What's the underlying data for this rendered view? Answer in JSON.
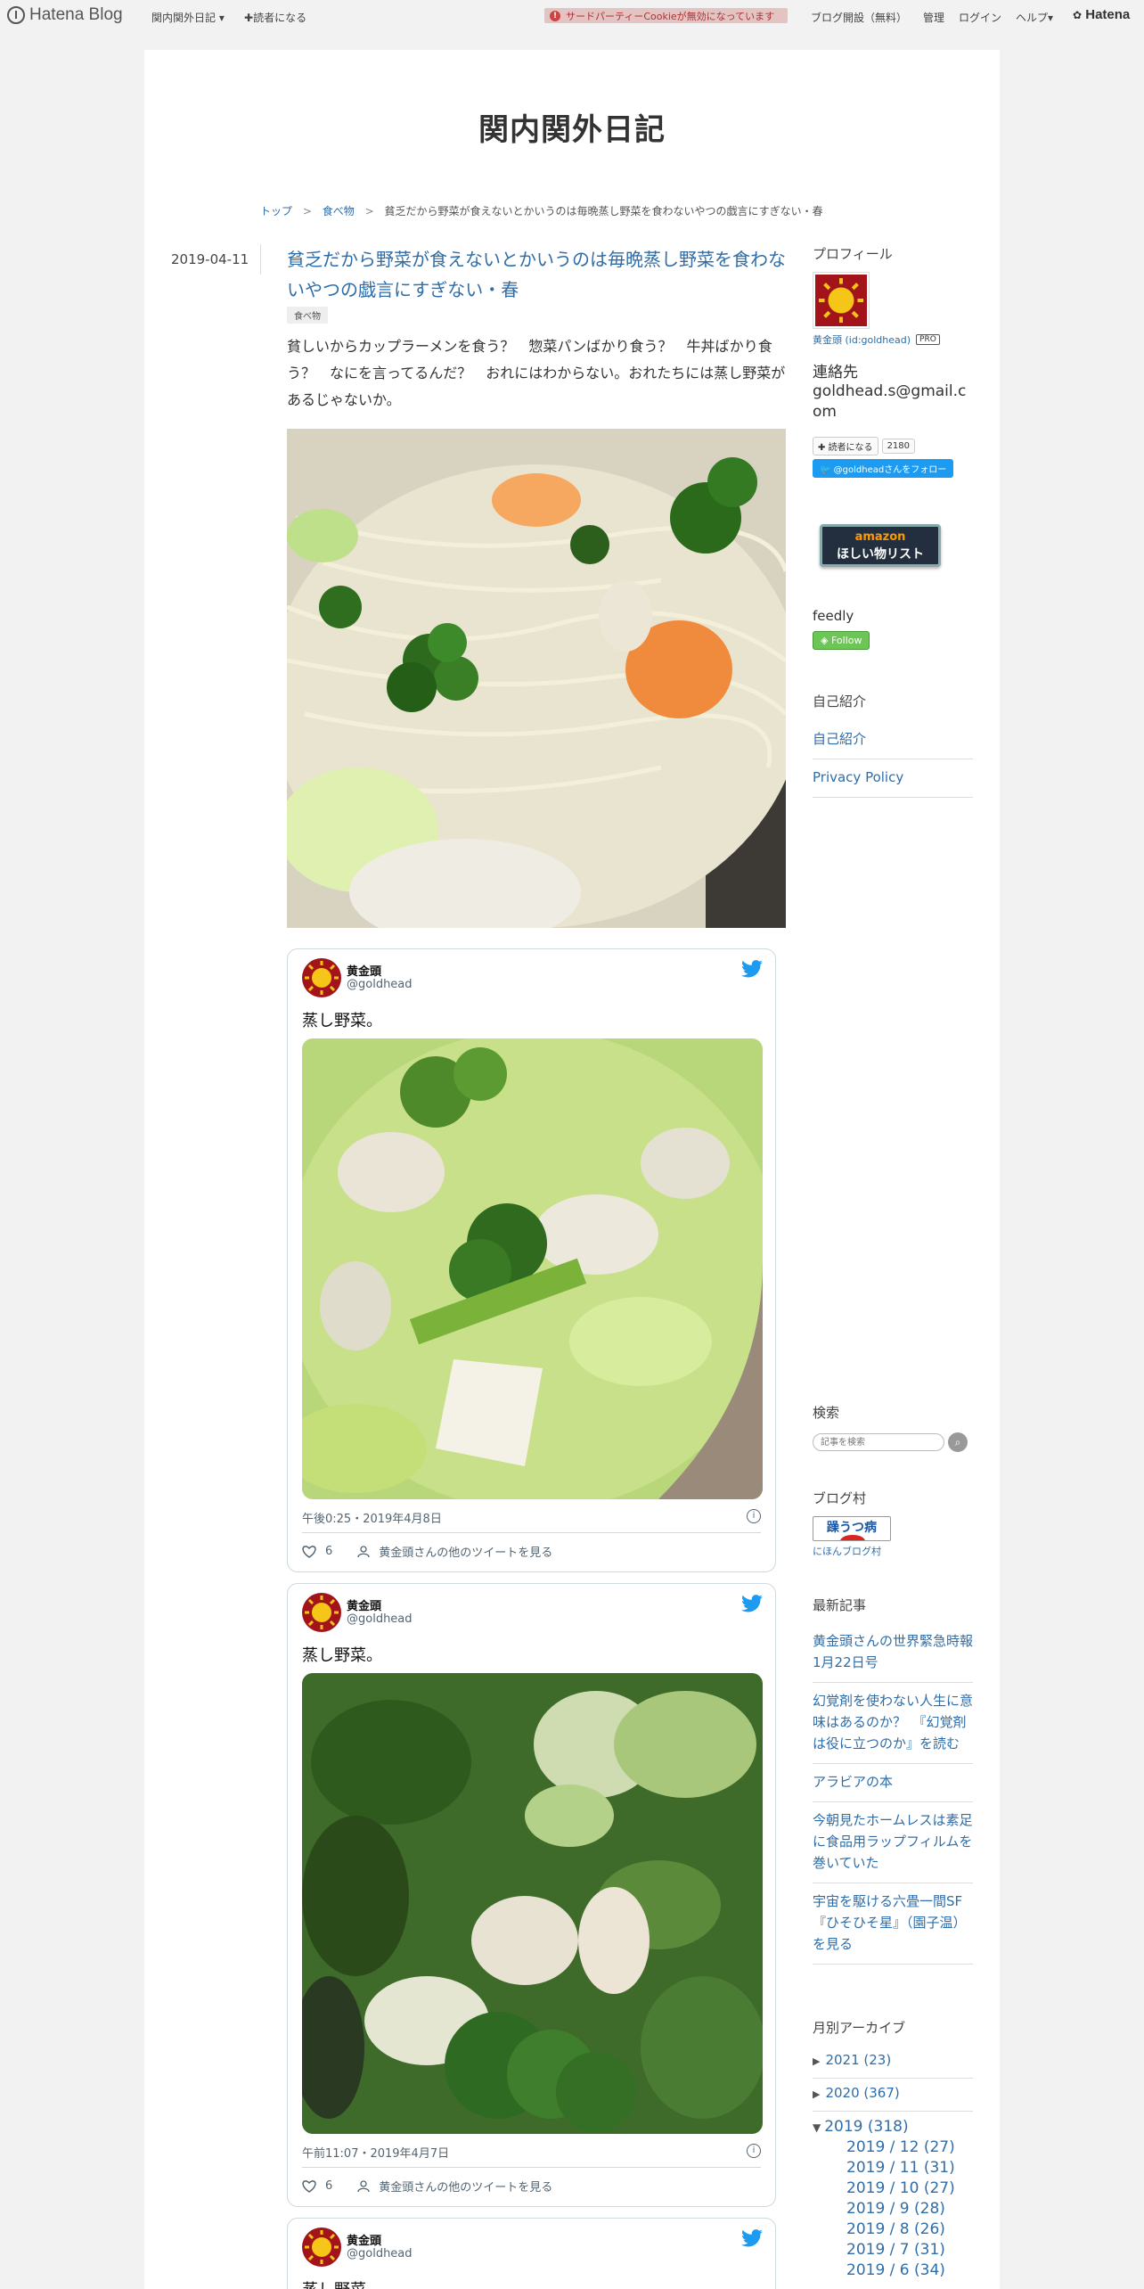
{
  "globalheader": {
    "logo": "Hatena Blog",
    "blog_menu": "関内関外日記",
    "subscribe": "読者になる",
    "cookie_notice": "サードパーティーCookieが無効になっています",
    "open_blog": "ブログ開設（無料）",
    "admin": "管理",
    "login": "ログイン",
    "help": "ヘルプ",
    "hatena": "Hatena"
  },
  "blog": {
    "title": "関内関外日記"
  },
  "breadcrumb": {
    "top": "トップ",
    "sep": ">",
    "category": "食べ物",
    "current": "貧乏だから野菜が食えないとかいうのは毎晩蒸し野菜を食わないやつの戯言にすぎない・春"
  },
  "entry": {
    "date": "2019-04-11",
    "title": "貧乏だから野菜が食えないとかいうのは毎晩蒸し野菜を食わないやつの戯言にすぎない・春",
    "category": "食べ物",
    "lead": "貧しいからカップラーメンを食う？　惣菜パンばかり食う？　牛丼ばかり食う？　なにを言ってるんだ？　おれにはわからない。おれたちには蒸し野菜があるじゃないか。"
  },
  "tweets": [
    {
      "name": "黄金頭",
      "handle": "@goldhead",
      "text": "蒸し野菜。",
      "time": "午後0:25・2019年4月8日",
      "likes": "6",
      "more": "黄金頭さんの他のツイートを見る"
    },
    {
      "name": "黄金頭",
      "handle": "@goldhead",
      "text": "蒸し野菜。",
      "time": "午前11:07・2019年4月7日",
      "likes": "6",
      "more": "黄金頭さんの他のツイートを見る"
    },
    {
      "name": "黄金頭",
      "handle": "@goldhead",
      "text": "蒸し野菜。"
    }
  ],
  "sidebar": {
    "profile_title": "プロフィール",
    "profile_name": "黄金頭 (id:goldhead)",
    "pro_badge": "PRO",
    "contact_label": "連絡先",
    "contact_email": "goldhead.s@gmail.com",
    "subscribe_button": "読者になる",
    "subscriber_count": "2180",
    "twitter_follow": "@goldheadさんをフォロー",
    "amazon_top": "amazon",
    "amazon_main": "ほしい物リスト",
    "feedly_title": "feedly",
    "feedly_button": "Follow",
    "intro_title": "自己紹介",
    "intro_links": [
      "自己紹介",
      "Privacy Policy"
    ],
    "search_title": "検索",
    "search_placeholder": "記事を検索",
    "village_title": "ブログ村",
    "village_badge": "躁うつ病",
    "village_link": "にほんブログ村",
    "recent_title": "最新記事",
    "recent": [
      "黄金頭さんの世界緊急時報　1月22日号",
      "幻覚剤を使わない人生に意味はあるのか？　『幻覚剤は役に立つのか』を読む",
      "アラビアの本",
      "今朝見たホームレスは素足に食品用ラップフィルムを巻いていた",
      "宇宙を駆ける六畳一間SF『ひそひそ星』（園子温）を見る"
    ],
    "archive_title": "月別アーカイブ",
    "archive_years": [
      {
        "marker": "▶",
        "label": "2021 (23)"
      },
      {
        "marker": "▶",
        "label": "2020 (367)"
      },
      {
        "marker": "▼",
        "label": "2019 (318)"
      }
    ],
    "archive_months": [
      "2019 / 12 (27)",
      "2019 / 11 (31)",
      "2019 / 10 (27)",
      "2019 / 9 (28)",
      "2019 / 8 (26)",
      "2019 / 7 (31)",
      "2019 / 6 (34)"
    ]
  }
}
